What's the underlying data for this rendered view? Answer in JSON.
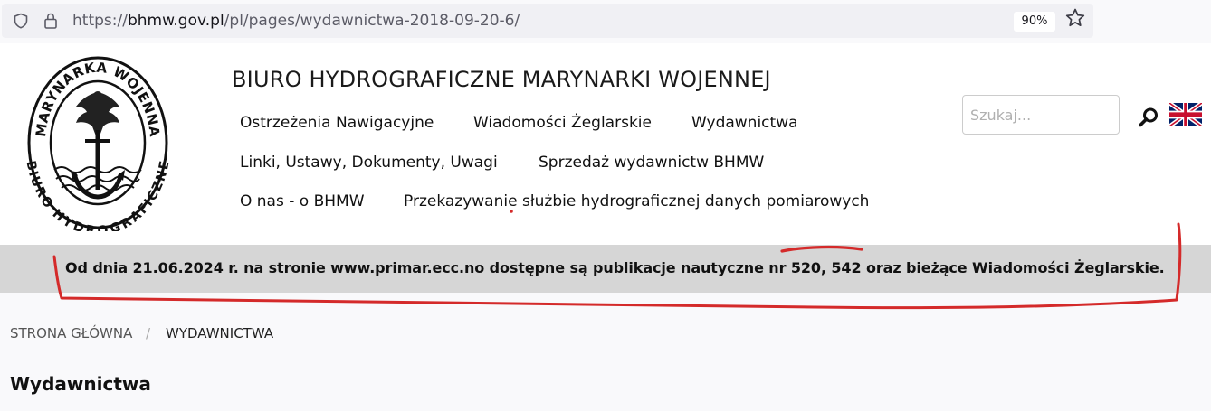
{
  "browser": {
    "url_prefix": "https://",
    "url_domain": "bhmw.gov.pl",
    "url_path": "/pl/pages/wydawnictwa-2018-09-20-6/",
    "zoom": "90%"
  },
  "logo": {
    "top_text": "MARYNARKA WOJENNA",
    "bottom_text": "BIURO HYDROGRAFICZNE"
  },
  "header": {
    "title": "BIURO HYDROGRAFICZNE MARYNARKI WOJENNEJ"
  },
  "nav": {
    "items": [
      "Ostrzeżenia Nawigacyjne",
      "Wiadomości Żeglarskie",
      "Wydawnictwa",
      "Linki, Ustawy, Dokumenty, Uwagi",
      "Sprzedaż wydawnictw BHMW",
      "O nas - o BHMW",
      "Przekazywanie służbie hydrograficznej danych pomiarowych"
    ]
  },
  "search": {
    "placeholder": "Szukaj..."
  },
  "announcement": {
    "text": "Od dnia 21.06.2024 r. na stronie www.primar.ecc.no dostępne są publikacje nautyczne nr 520, 542 oraz bieżące Wiadomości Żeglarskie."
  },
  "breadcrumb": {
    "home": "STRONA GŁÓWNA",
    "separator": "/",
    "current": "WYDAWNICTWA"
  },
  "page": {
    "title": "Wydawnictwa"
  },
  "colors": {
    "annotation": "#d42a2a",
    "band": "#d6d6d6",
    "urlbar": "#f0f0f4"
  },
  "icons": [
    "shield-icon",
    "lock-icon",
    "star-icon",
    "search-icon",
    "uk-flag-icon"
  ]
}
